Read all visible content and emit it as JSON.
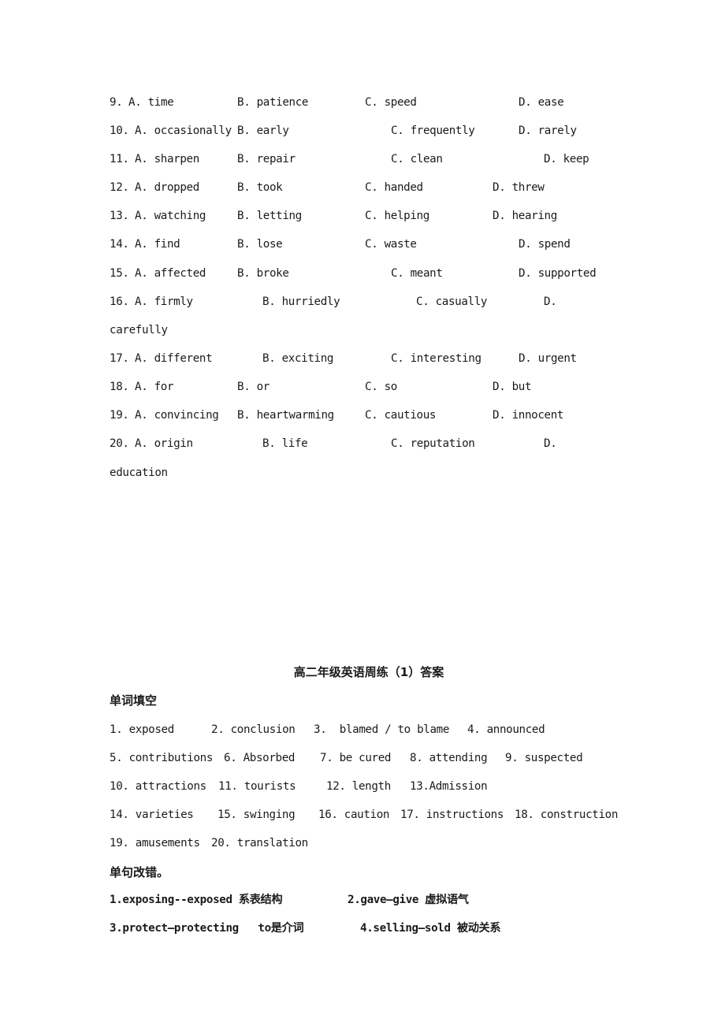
{
  "choices": [
    {
      "num": "9.",
      "A": "A. time",
      "B": "B. patience",
      "C": "C. speed",
      "D": "D. ease"
    },
    {
      "num": "10.",
      "A": "A. occasionally",
      "B": "B. early",
      "C": "C. frequently",
      "D": "D. rarely"
    },
    {
      "num": "11.",
      "A": "A. sharpen",
      "B": "B. repair",
      "C": "C. clean",
      "D": "D. keep"
    },
    {
      "num": "12.",
      "A": "A. dropped",
      "B": "B. took",
      "C": "C. handed",
      "D": "D. threw"
    },
    {
      "num": "13.",
      "A": "A. watching",
      "B": "B. letting",
      "C": "C. helping",
      "D": "D. hearing"
    },
    {
      "num": "14.",
      "A": "A. find",
      "B": "B. lose",
      "C": "C. waste",
      "D": "D. spend"
    },
    {
      "num": "15.",
      "A": "A. affected",
      "B": "B. broke",
      "C": "C. meant",
      "D": "D. supported"
    },
    {
      "num": "16.",
      "A": "A. firmly",
      "B": "B. hurriedly",
      "C": "C. casually",
      "D": "D.",
      "D_wrap": "carefully"
    },
    {
      "num": "17.",
      "A": "A. different",
      "B": "B. exciting",
      "C": "C. interesting",
      "D": "D. urgent"
    },
    {
      "num": "18.",
      "A": "A. for",
      "B": "B. or",
      "C": "C. so",
      "D": "D. but"
    },
    {
      "num": "19.",
      "A": "A. convincing",
      "B": "B. heartwarming",
      "C": "C. cautious",
      "D": "D. innocent"
    },
    {
      "num": "20.",
      "A": "A. origin",
      "B": "B. life",
      "C": "C. reputation",
      "D": "D.",
      "D_wrap": "education"
    }
  ],
  "answer_key": {
    "title": "高二年级英语周练（1）答案",
    "word_fill": {
      "heading": "单词填空",
      "lines": [
        [
          "1. exposed",
          "2. conclusion",
          "3.  blamed / to blame",
          "4. announced"
        ],
        [
          "5. contributions",
          "6. Absorbed",
          "7. be cured",
          "8. attending",
          "9. suspected"
        ],
        [
          "10. attractions",
          "11. tourists",
          "12. length",
          "13.Admission"
        ],
        [
          "14. varieties",
          "15. swinging",
          "16. caution",
          "17. instructions",
          "18. construction"
        ],
        [
          "19. amusements",
          "20. translation"
        ]
      ]
    },
    "error_correction": {
      "heading": "单句改错。",
      "items": [
        "1.exposing--exposed 系表结构",
        "2.gave—give 虚拟语气",
        "3.protect—protecting   to是介词",
        "4.selling—sold 被动关系"
      ]
    }
  }
}
